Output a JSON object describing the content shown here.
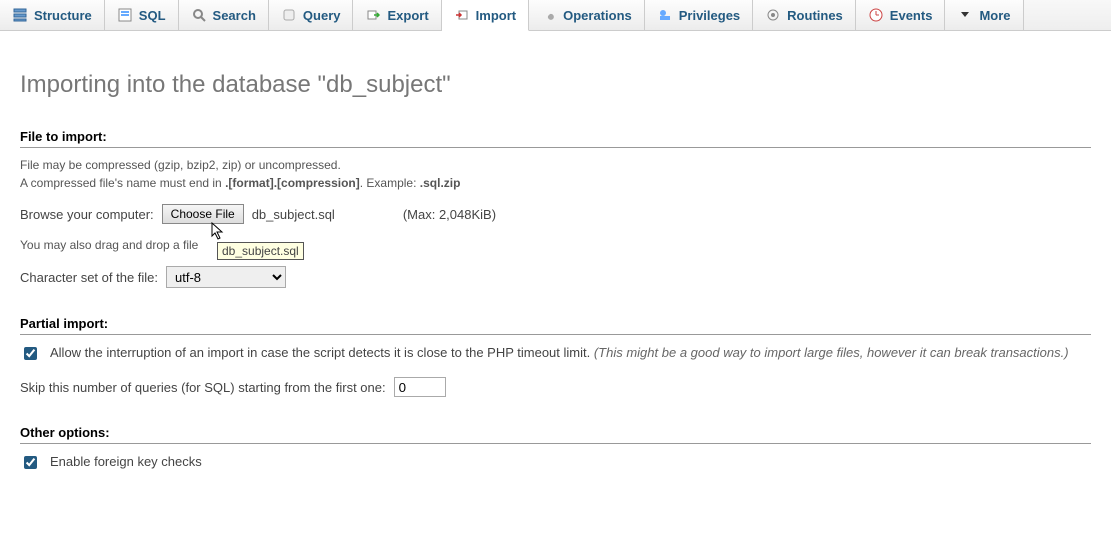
{
  "tabs": {
    "structure": "Structure",
    "sql": "SQL",
    "search": "Search",
    "query": "Query",
    "export": "Export",
    "import": "Import",
    "operations": "Operations",
    "privileges": "Privileges",
    "routines": "Routines",
    "events": "Events",
    "more": "More"
  },
  "page_title": "Importing into the database \"db_subject\"",
  "file_import": {
    "section": "File to import:",
    "note1": "File may be compressed (gzip, bzip2, zip) or uncompressed.",
    "note2a": "A compressed file's name must end in ",
    "note2b": ".[format].[compression]",
    "note2c": ". Example: ",
    "note2d": ".sql.zip",
    "browse_label": "Browse your computer:",
    "choose_btn": "Choose File",
    "filename": "db_subject.sql",
    "max": "(Max: 2,048KiB)",
    "dragdrop": "You may also drag and drop a file",
    "tooltip": "db_subject.sql",
    "charset_label": "Character set of the file:",
    "charset_value": "utf-8"
  },
  "partial": {
    "section": "Partial import:",
    "allow_label_a": "Allow the interruption of an import in case the script detects it is close to the PHP timeout limit. ",
    "allow_label_b": "(This might be a good way to import large files, however it can break transactions.)",
    "allow_checked": true,
    "skip_label": "Skip this number of queries (for SQL) starting from the first one:",
    "skip_value": "0"
  },
  "other": {
    "section": "Other options:",
    "fk_label": "Enable foreign key checks",
    "fk_checked": true
  }
}
